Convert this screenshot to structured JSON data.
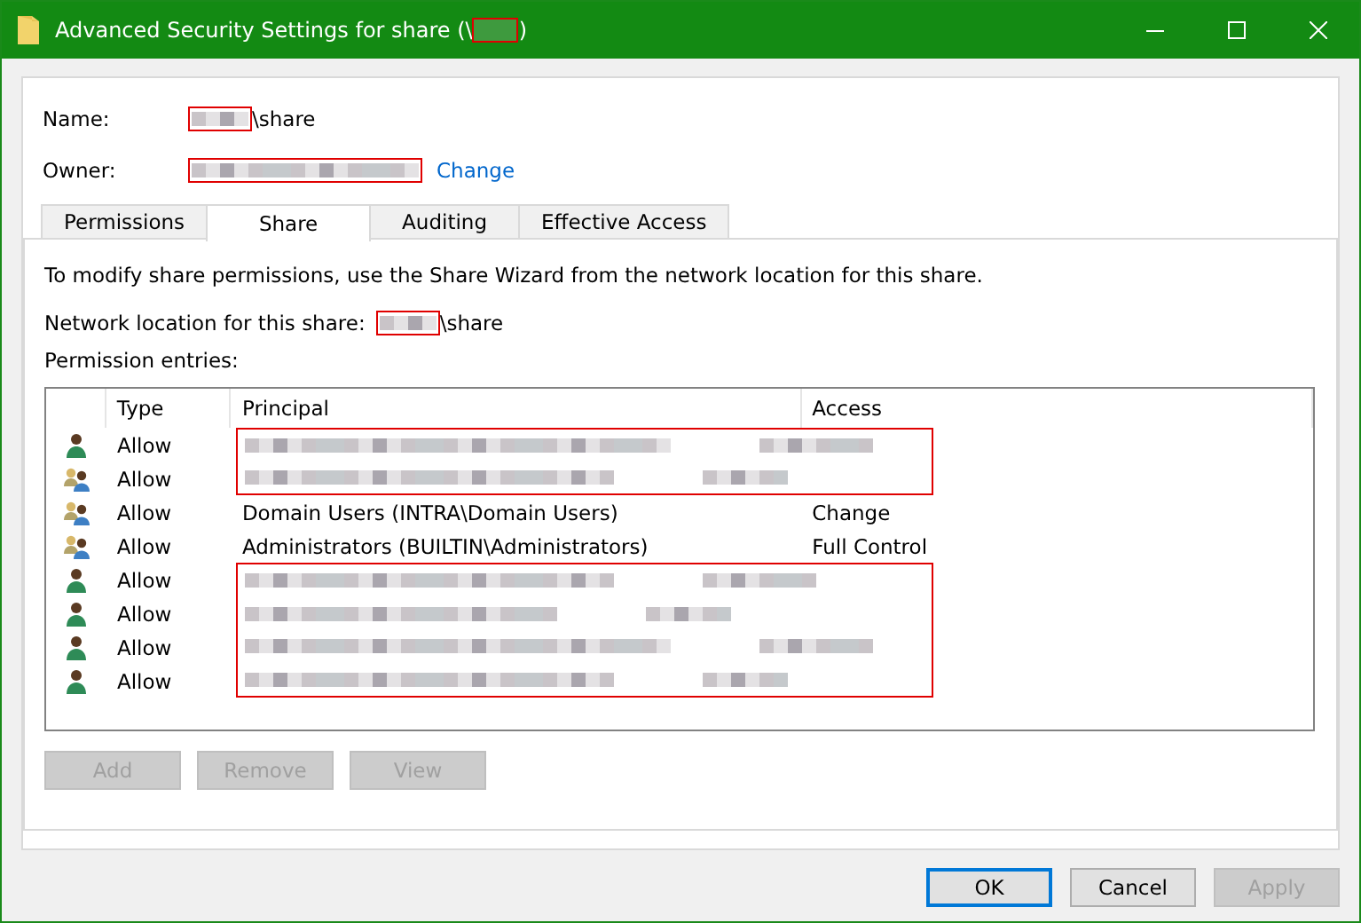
{
  "window": {
    "title_prefix": "Advanced Security Settings for share (\\",
    "title_redacted": true,
    "title_suffix": ")"
  },
  "name": {
    "label": "Name:",
    "redacted": true,
    "value": "\\share"
  },
  "owner": {
    "label": "Owner:",
    "redacted": true,
    "link": "Change"
  },
  "tabs": [
    {
      "label": "Permissions",
      "selected": false
    },
    {
      "label": "Share",
      "selected": true
    },
    {
      "label": "Auditing",
      "selected": false
    },
    {
      "label": "Effective Access",
      "selected": false
    }
  ],
  "info": "To modify share permissions, use the Share Wizard from the network location for this share.",
  "network_location": {
    "label": "Network location for this share:",
    "redacted": true,
    "value": "\\share"
  },
  "entries_label": "Permission entries:",
  "table": {
    "columns": [
      "Type",
      "Principal",
      "Access"
    ],
    "rows": [
      {
        "kind": "user",
        "type": "Allow",
        "redacted": true
      },
      {
        "kind": "group",
        "type": "Allow",
        "redacted": true
      },
      {
        "kind": "group",
        "type": "Allow",
        "redacted": false,
        "principal": "Domain Users (INTRA\\Domain Users)",
        "access": "Change"
      },
      {
        "kind": "group",
        "type": "Allow",
        "redacted": false,
        "principal": "Administrators (BUILTIN\\Administrators)",
        "access": "Full Control"
      },
      {
        "kind": "user",
        "type": "Allow",
        "redacted": true
      },
      {
        "kind": "user",
        "type": "Allow",
        "redacted": true
      },
      {
        "kind": "user",
        "type": "Allow",
        "redacted": true
      },
      {
        "kind": "user",
        "type": "Allow",
        "redacted": true
      }
    ]
  },
  "entry_buttons": [
    {
      "label": "Add",
      "disabled": true
    },
    {
      "label": "Remove",
      "disabled": true
    },
    {
      "label": "View",
      "disabled": true
    }
  ],
  "dialog_buttons": [
    {
      "label": "OK",
      "disabled": false,
      "default": true
    },
    {
      "label": "Cancel",
      "disabled": false,
      "default": false
    },
    {
      "label": "Apply",
      "disabled": true,
      "default": false
    }
  ]
}
